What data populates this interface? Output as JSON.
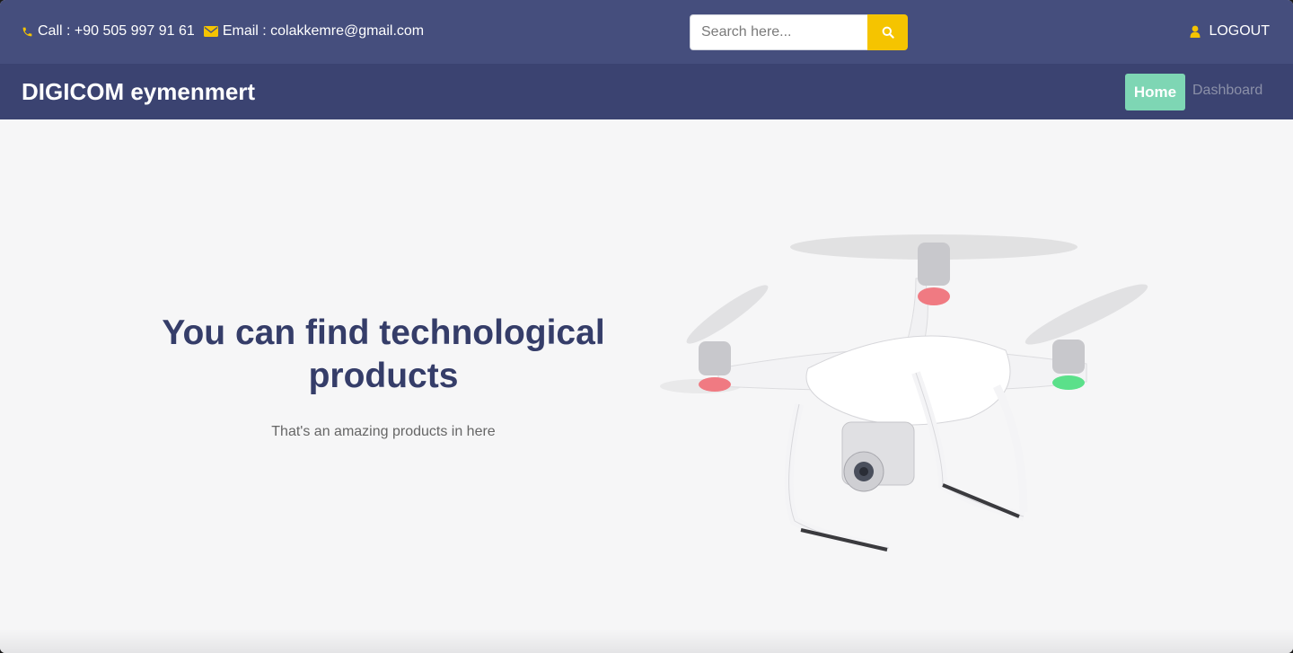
{
  "topbar": {
    "call_text": "Call : +90 505 997 91 61",
    "email_text": "Email : colakkemre@gmail.com",
    "search_placeholder": "Search here...",
    "logout_label": "LOGOUT"
  },
  "navbar": {
    "brand": "DIGICOM eymenmert",
    "items": [
      {
        "label": "Home",
        "active": true
      },
      {
        "label": "Dashboard",
        "active": false
      }
    ]
  },
  "hero": {
    "title": "You can find technological products",
    "subtitle": "That's an amazing products in here"
  },
  "colors": {
    "topbar_bg": "#454e7d",
    "navbar_bg": "#3b4371",
    "accent_yellow": "#f5c400",
    "home_active": "#7ed6b4",
    "title_color": "#353d69"
  },
  "icons": [
    "phone-icon",
    "envelope-icon",
    "search-icon",
    "user-icon"
  ]
}
